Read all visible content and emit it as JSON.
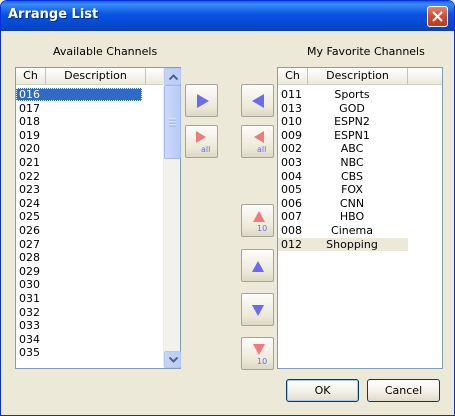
{
  "window": {
    "title": "Arrange List"
  },
  "available": {
    "heading": "Available Channels",
    "columns": {
      "ch": "Ch",
      "desc": "Description"
    },
    "rows": [
      {
        "ch": "016",
        "desc": "",
        "selected": true
      },
      {
        "ch": "017",
        "desc": ""
      },
      {
        "ch": "018",
        "desc": ""
      },
      {
        "ch": "019",
        "desc": ""
      },
      {
        "ch": "020",
        "desc": ""
      },
      {
        "ch": "021",
        "desc": ""
      },
      {
        "ch": "022",
        "desc": ""
      },
      {
        "ch": "023",
        "desc": ""
      },
      {
        "ch": "024",
        "desc": ""
      },
      {
        "ch": "025",
        "desc": ""
      },
      {
        "ch": "026",
        "desc": ""
      },
      {
        "ch": "027",
        "desc": ""
      },
      {
        "ch": "028",
        "desc": ""
      },
      {
        "ch": "029",
        "desc": ""
      },
      {
        "ch": "030",
        "desc": ""
      },
      {
        "ch": "031",
        "desc": ""
      },
      {
        "ch": "032",
        "desc": ""
      },
      {
        "ch": "033",
        "desc": ""
      },
      {
        "ch": "034",
        "desc": ""
      },
      {
        "ch": "035",
        "desc": ""
      }
    ]
  },
  "favorites": {
    "heading": "My Favorite Channels",
    "columns": {
      "ch": "Ch",
      "desc": "Description"
    },
    "rows": [
      {
        "ch": "011",
        "desc": "Sports"
      },
      {
        "ch": "013",
        "desc": "GOD"
      },
      {
        "ch": "010",
        "desc": "ESPN2"
      },
      {
        "ch": "009",
        "desc": "ESPN1"
      },
      {
        "ch": "002",
        "desc": "ABC"
      },
      {
        "ch": "003",
        "desc": "NBC"
      },
      {
        "ch": "004",
        "desc": "CBS"
      },
      {
        "ch": "005",
        "desc": "FOX"
      },
      {
        "ch": "006",
        "desc": "CNN"
      },
      {
        "ch": "007",
        "desc": "HBO"
      },
      {
        "ch": "008",
        "desc": "Cinema"
      },
      {
        "ch": "012",
        "desc": "Shopping",
        "highlighted": true
      }
    ]
  },
  "buttons": {
    "add_all_sub": "all",
    "remove_all_sub": "all",
    "move_up_10_sub": "10",
    "move_down_10_sub": "10",
    "ok": "OK",
    "cancel": "Cancel"
  },
  "icons": {
    "add": "triangle-right-icon",
    "add_all": "triangle-right-icon",
    "remove": "triangle-left-icon",
    "remove_all": "triangle-left-icon",
    "up10": "triangle-up-icon",
    "up": "triangle-up-icon",
    "down": "triangle-down-icon",
    "down10": "triangle-down-icon"
  },
  "colors": {
    "blue_arrow": "#6b6bef",
    "red_arrow": "#f07a7a",
    "selection": "#316ac5",
    "titlebar": "#0753e2"
  }
}
